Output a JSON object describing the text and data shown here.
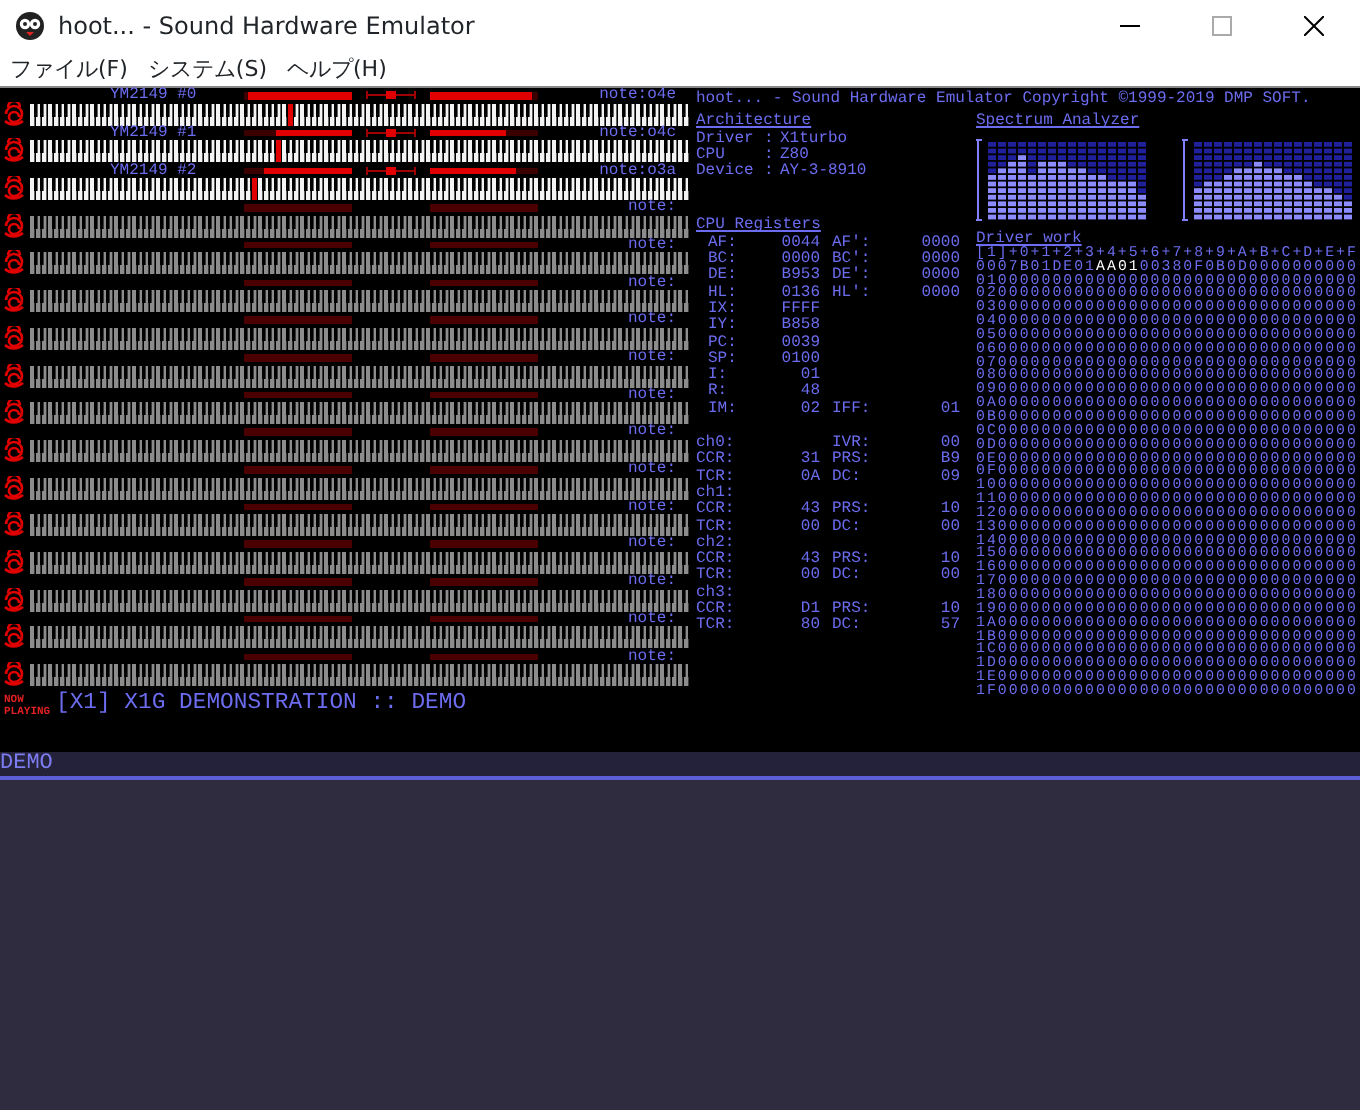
{
  "window": {
    "title": "hoot... - Sound Hardware Emulator"
  },
  "menu": [
    {
      "label": "ファイル(F)"
    },
    {
      "label": "システム(S)"
    },
    {
      "label": "ヘルプ(H)"
    }
  ],
  "channels": [
    {
      "name": "YM2149 #0",
      "note": "note:o4e",
      "active": true,
      "meters": [
        {
          "level": 0.96
        },
        {
          "level": 0.95
        }
      ],
      "pan": {
        "level": 0.5
      },
      "key": {
        "level": 0.39
      }
    },
    {
      "name": "YM2149 #1",
      "note": "note:o4c",
      "active": true,
      "meters": [
        {
          "level": 0.7
        },
        {
          "level": 0.7
        }
      ],
      "pan": {
        "level": 0.5
      },
      "key": {
        "level": 0.37
      }
    },
    {
      "name": "YM2149 #2",
      "note": "note:o3a",
      "active": true,
      "meters": [
        {
          "level": 0.81
        },
        {
          "level": 0.8
        }
      ],
      "pan": {
        "level": 0.5
      },
      "key": {
        "level": 0.34
      }
    },
    {
      "note": "note:",
      "active": false
    },
    {
      "note": "note:",
      "active": false
    },
    {
      "note": "note:",
      "active": false
    },
    {
      "note": "note:",
      "active": false
    },
    {
      "note": "note:",
      "active": false
    },
    {
      "note": "note:",
      "active": false
    },
    {
      "note": "note:",
      "active": false
    },
    {
      "note": "note:",
      "active": false
    },
    {
      "note": "note:",
      "active": false
    },
    {
      "note": "note:",
      "active": false
    },
    {
      "note": "note:",
      "active": false
    },
    {
      "note": "note:",
      "active": false
    },
    {
      "note": "note:",
      "active": false
    }
  ],
  "now_playing": {
    "badge": [
      "NOW",
      "PLAYING"
    ],
    "title": "[X1] X1G DEMONSTRATION :: DEMO"
  },
  "info": {
    "header": "hoot... - Sound Hardware Emulator Copyright ©1999-2019 DMP SOFT.",
    "architecture": {
      "title": "Architecture",
      "rows": [
        {
          "label": "Driver",
          "sep": ":",
          "value": "X1turbo"
        },
        {
          "label": "CPU",
          "sep": ":",
          "value": "Z80"
        },
        {
          "label": "Device",
          "sep": ":",
          "value": "AY-3-8910"
        }
      ]
    },
    "spectrum": {
      "title": "Spectrum Analyzer"
    },
    "registers": {
      "title": "CPU Registers",
      "rows": [
        {
          "kind": "register",
          "label": "AF:",
          "value": "0044",
          "label2": "AF':",
          "value2": "0000"
        },
        {
          "kind": "register",
          "label": "BC:",
          "value": "0000",
          "label2": "BC':",
          "value2": "0000"
        },
        {
          "kind": "register",
          "label": "DE:",
          "value": "B953",
          "label2": "DE':",
          "value2": "0000"
        },
        {
          "kind": "register",
          "label": "HL:",
          "value": "0136",
          "label2": "HL':",
          "value2": "0000"
        },
        {
          "kind": "register",
          "label": "IX:",
          "value": "FFFF"
        },
        {
          "kind": "register",
          "label": "IY:",
          "value": "B858"
        },
        {
          "kind": "register",
          "label": "PC:",
          "value": "0039"
        },
        {
          "kind": "register",
          "label": "SP:",
          "value": "0100"
        },
        {
          "kind": "register",
          "label": "I:",
          "value": "01"
        },
        {
          "kind": "register",
          "label": "R:",
          "value": "48"
        },
        {
          "kind": "register",
          "label": "IM:",
          "value": "02",
          "label2": "IFF:",
          "value2": "01"
        },
        {
          "kind": "section",
          "label": "ch0:",
          "label2": "IVR:",
          "value2": "00"
        },
        {
          "kind": "timer",
          "label": "CCR:",
          "value": "31",
          "label2": "PRS:",
          "value2": "B9"
        },
        {
          "kind": "timer",
          "label": "TCR:",
          "value": "0A",
          "label2": "DC:",
          "value2": "09"
        },
        {
          "kind": "timer",
          "label": "ch1:"
        },
        {
          "kind": "timer",
          "label": "CCR:",
          "value": "43",
          "label2": "PRS:",
          "value2": "10"
        },
        {
          "kind": "timer",
          "label": "TCR:",
          "value": "00",
          "label2": "DC:",
          "value2": "00"
        },
        {
          "kind": "timer",
          "label": "ch2:"
        },
        {
          "kind": "timer",
          "label": "CCR:",
          "value": "43",
          "label2": "PRS:",
          "value2": "10"
        },
        {
          "kind": "timer",
          "label": "TCR:",
          "value": "00",
          "label2": "DC:",
          "value2": "00"
        },
        {
          "kind": "timer",
          "label": "ch3:"
        },
        {
          "kind": "timer",
          "label": "CCR:",
          "value": "D1",
          "label2": "PRS:",
          "value2": "10"
        },
        {
          "kind": "timer",
          "label": "TCR:",
          "value": "80",
          "label2": "DC:",
          "value2": "57"
        }
      ]
    },
    "driver_work": {
      "title": "Driver work",
      "header": "[1]+0+1+2+3+4+5+6+7+8+9+A+B+C+D+E+F",
      "rows": [
        {
          "address": "000",
          "segments": [
            {
              "text": "7B01DE01",
              "highlight": false
            },
            {
              "text": "AA01",
              "highlight": true
            },
            {
              "text": "00380F0B0D0000000000",
              "highlight": false
            }
          ]
        },
        {
          "address": "010",
          "segments": [
            {
              "text": "00000000000000000000000000000000",
              "highlight": false
            }
          ]
        },
        {
          "address": "020",
          "segments": [
            {
              "text": "00000000000000000000000000000000",
              "highlight": false
            }
          ]
        },
        {
          "address": "030",
          "segments": [
            {
              "text": "00000000000000000000000000000000",
              "highlight": false
            }
          ]
        },
        {
          "address": "040",
          "segments": [
            {
              "text": "00000000000000000000000000000000",
              "highlight": false
            }
          ]
        },
        {
          "address": "050",
          "segments": [
            {
              "text": "00000000000000000000000000000000",
              "highlight": false
            }
          ]
        },
        {
          "address": "060",
          "segments": [
            {
              "text": "00000000000000000000000000000000",
              "highlight": false
            }
          ]
        },
        {
          "address": "070",
          "segments": [
            {
              "text": "00000000000000000000000000000000",
              "highlight": false
            }
          ]
        },
        {
          "address": "080",
          "segments": [
            {
              "text": "00000000000000000000000000000000",
              "highlight": false
            }
          ]
        },
        {
          "address": "090",
          "segments": [
            {
              "text": "00000000000000000000000000000000",
              "highlight": false
            }
          ]
        },
        {
          "address": "0A0",
          "segments": [
            {
              "text": "00000000000000000000000000000000",
              "highlight": false
            }
          ]
        },
        {
          "address": "0B0",
          "segments": [
            {
              "text": "00000000000000000000000000000000",
              "highlight": false
            }
          ]
        },
        {
          "address": "0C0",
          "segments": [
            {
              "text": "00000000000000000000000000000000",
              "highlight": false
            }
          ]
        },
        {
          "address": "0D0",
          "segments": [
            {
              "text": "00000000000000000000000000000000",
              "highlight": false
            }
          ]
        },
        {
          "address": "0E0",
          "segments": [
            {
              "text": "00000000000000000000000000000000",
              "highlight": false
            }
          ]
        },
        {
          "address": "0F0",
          "segments": [
            {
              "text": "00000000000000000000000000000000",
              "highlight": false
            }
          ]
        },
        {
          "address": "100",
          "segments": [
            {
              "text": "00000000000000000000000000000000",
              "highlight": false
            }
          ]
        },
        {
          "address": "110",
          "segments": [
            {
              "text": "00000000000000000000000000000000",
              "highlight": false
            }
          ]
        },
        {
          "address": "120",
          "segments": [
            {
              "text": "00000000000000000000000000000000",
              "highlight": false
            }
          ]
        },
        {
          "address": "130",
          "segments": [
            {
              "text": "00000000000000000000000000000000",
              "highlight": false
            }
          ]
        },
        {
          "address": "140",
          "segments": [
            {
              "text": "00000000000000000000000000000000",
              "highlight": false
            }
          ]
        },
        {
          "address": "150",
          "segments": [
            {
              "text": "00000000000000000000000000000000",
              "highlight": false
            }
          ]
        },
        {
          "address": "160",
          "segments": [
            {
              "text": "00000000000000000000000000000000",
              "highlight": false
            }
          ]
        },
        {
          "address": "170",
          "segments": [
            {
              "text": "00000000000000000000000000000000",
              "highlight": false
            }
          ]
        },
        {
          "address": "180",
          "segments": [
            {
              "text": "00000000000000000000000000000000",
              "highlight": false
            }
          ]
        },
        {
          "address": "190",
          "segments": [
            {
              "text": "00000000000000000000000000000000",
              "highlight": false
            }
          ]
        },
        {
          "address": "1A0",
          "segments": [
            {
              "text": "00000000000000000000000000000000",
              "highlight": false
            }
          ]
        },
        {
          "address": "1B0",
          "segments": [
            {
              "text": "00000000000000000000000000000000",
              "highlight": false
            }
          ]
        },
        {
          "address": "1C0",
          "segments": [
            {
              "text": "00000000000000000000000000000000",
              "highlight": false
            }
          ]
        },
        {
          "address": "1D0",
          "segments": [
            {
              "text": "00000000000000000000000000000000",
              "highlight": false
            }
          ]
        },
        {
          "address": "1E0",
          "segments": [
            {
              "text": "00000000000000000000000000000000",
              "highlight": false
            }
          ]
        },
        {
          "address": "1F0",
          "segments": [
            {
              "text": "00000000000000000000000000000000",
              "highlight": false
            }
          ]
        }
      ]
    }
  },
  "playlist": [
    {
      "title": "DEMO"
    }
  ]
}
